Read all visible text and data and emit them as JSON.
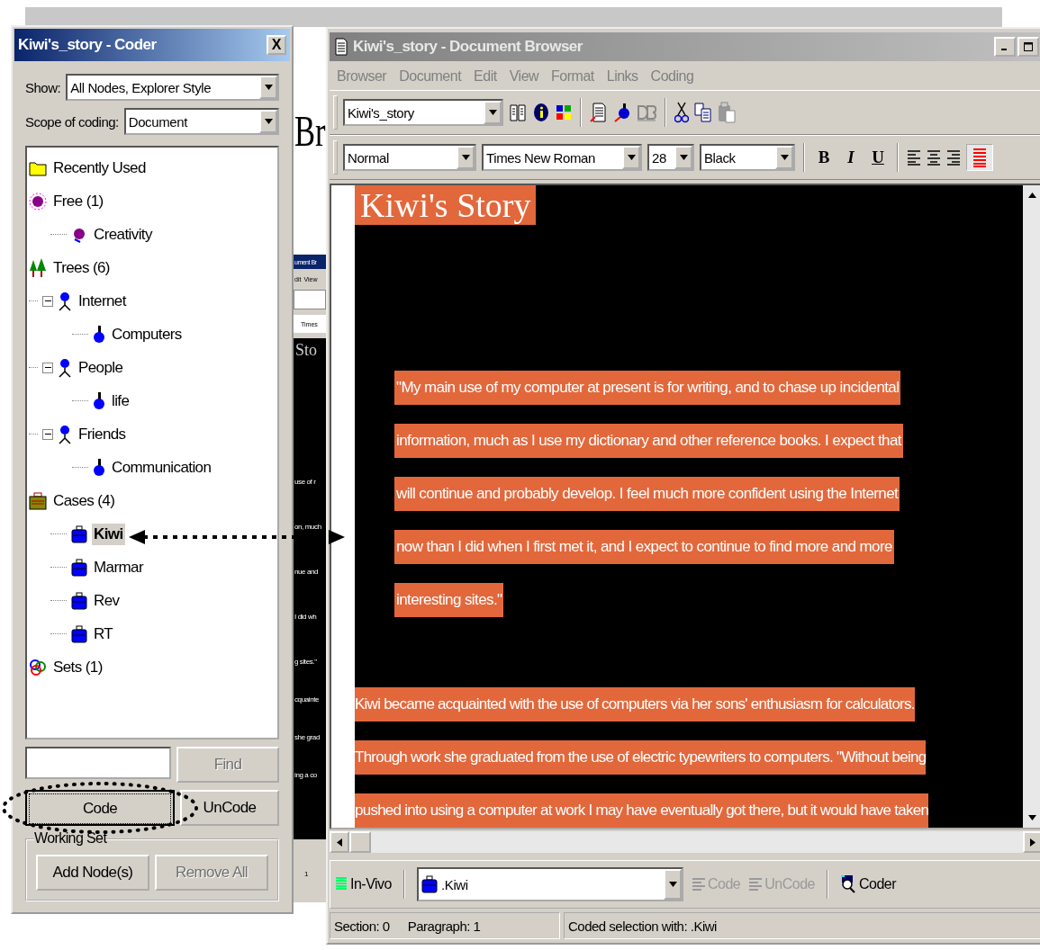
{
  "background": {
    "heading_fragment": "Br",
    "window": {
      "title_fragment": "ument Br",
      "menu_fragments": [
        "dit",
        "View"
      ],
      "font_fragment": "Times",
      "heading_fragment": "Sto",
      "paragraphs": [
        [
          "use of r",
          "on, much",
          "nue and",
          "I did wh",
          "g sites.\""
        ],
        [
          "cquainte",
          "she grad",
          "ing a co"
        ]
      ],
      "status_fragment": "1"
    }
  },
  "coder": {
    "title": "Kiwi's_story - Coder",
    "close": "X",
    "show": {
      "label": "Show:",
      "value": "All Nodes, Explorer Style"
    },
    "scope": {
      "label": "Scope of coding:",
      "value": "Document"
    },
    "tree": [
      {
        "kind": "folder",
        "label": "Recently Used",
        "selected": false
      },
      {
        "kind": "free",
        "label": "Free (1)",
        "selected": false,
        "children": [
          {
            "kind": "freenode",
            "label": "Creativity",
            "selected": false
          }
        ]
      },
      {
        "kind": "trees",
        "label": "Trees (6)",
        "selected": false,
        "children": [
          {
            "kind": "treenode",
            "label": "Internet",
            "selected": false,
            "expanded": true,
            "children": [
              {
                "kind": "leaf",
                "label": "Computers",
                "selected": false
              }
            ]
          },
          {
            "kind": "treenode",
            "label": "People",
            "selected": false,
            "expanded": true,
            "children": [
              {
                "kind": "leaf",
                "label": "life",
                "selected": false
              }
            ]
          },
          {
            "kind": "treenode",
            "label": "Friends",
            "selected": false,
            "expanded": true,
            "children": [
              {
                "kind": "leaf",
                "label": "Communication",
                "selected": false
              }
            ]
          }
        ]
      },
      {
        "kind": "cases",
        "label": "Cases (4)",
        "selected": false,
        "children": [
          {
            "kind": "case",
            "label": "Kiwi",
            "selected": true
          },
          {
            "kind": "case",
            "label": "Marmar",
            "selected": false
          },
          {
            "kind": "case",
            "label": "Rev",
            "selected": false
          },
          {
            "kind": "case",
            "label": "RT",
            "selected": false
          }
        ]
      },
      {
        "kind": "sets",
        "label": "Sets (1)",
        "selected": false
      }
    ],
    "find": {
      "label": "Find",
      "disabled": true
    },
    "code": {
      "label": "Code",
      "disabled": false
    },
    "uncode": {
      "label": "UnCode",
      "disabled": false
    },
    "working_set": {
      "title": "Working Set",
      "buttons": [
        {
          "label": "Add Node(s)",
          "disabled": false
        },
        {
          "label": "Remove All",
          "disabled": true
        }
      ]
    }
  },
  "browser": {
    "title": "Kiwi's_story - Document Browser",
    "menu": [
      "Browser",
      "Document",
      "Edit",
      "View",
      "Format",
      "Links",
      "Coding"
    ],
    "document": "Kiwi's_story",
    "style": "Normal",
    "font": "Times New Roman",
    "size": "28",
    "text_color": "Black",
    "format_buttons": [
      {
        "label": "B",
        "kind": "bold"
      },
      {
        "label": "I",
        "kind": "italic"
      },
      {
        "label": "U",
        "kind": "underline"
      }
    ],
    "heading": "Kiwi's Story",
    "quote": [
      "\"My main use of my computer at present is for writing, and to chase up incidental",
      "information, much as I use my dictionary and other reference books. I expect that",
      "will continue and probably develop. I feel much more confident using the Internet",
      "now than I did when I first met it, and I expect to continue to find more and more",
      "interesting sites.\""
    ],
    "body": [
      "Kiwi became acquainted with the use of computers via her sons' enthusiasm for calculators.",
      "Through work she graduated from the use of electric typewriters to computers. \"Without being",
      "pushed into using a computer at work I may have eventually got there, but it would have taken"
    ],
    "in_vivo": "In-Vivo",
    "node": ".Kiwi",
    "code": "Code",
    "uncode": "UnCode",
    "coder": "Coder",
    "status": {
      "section": "Section: 0",
      "paragraph": "Paragraph: 1",
      "coded": "Coded selection with: .Kiwi"
    }
  }
}
